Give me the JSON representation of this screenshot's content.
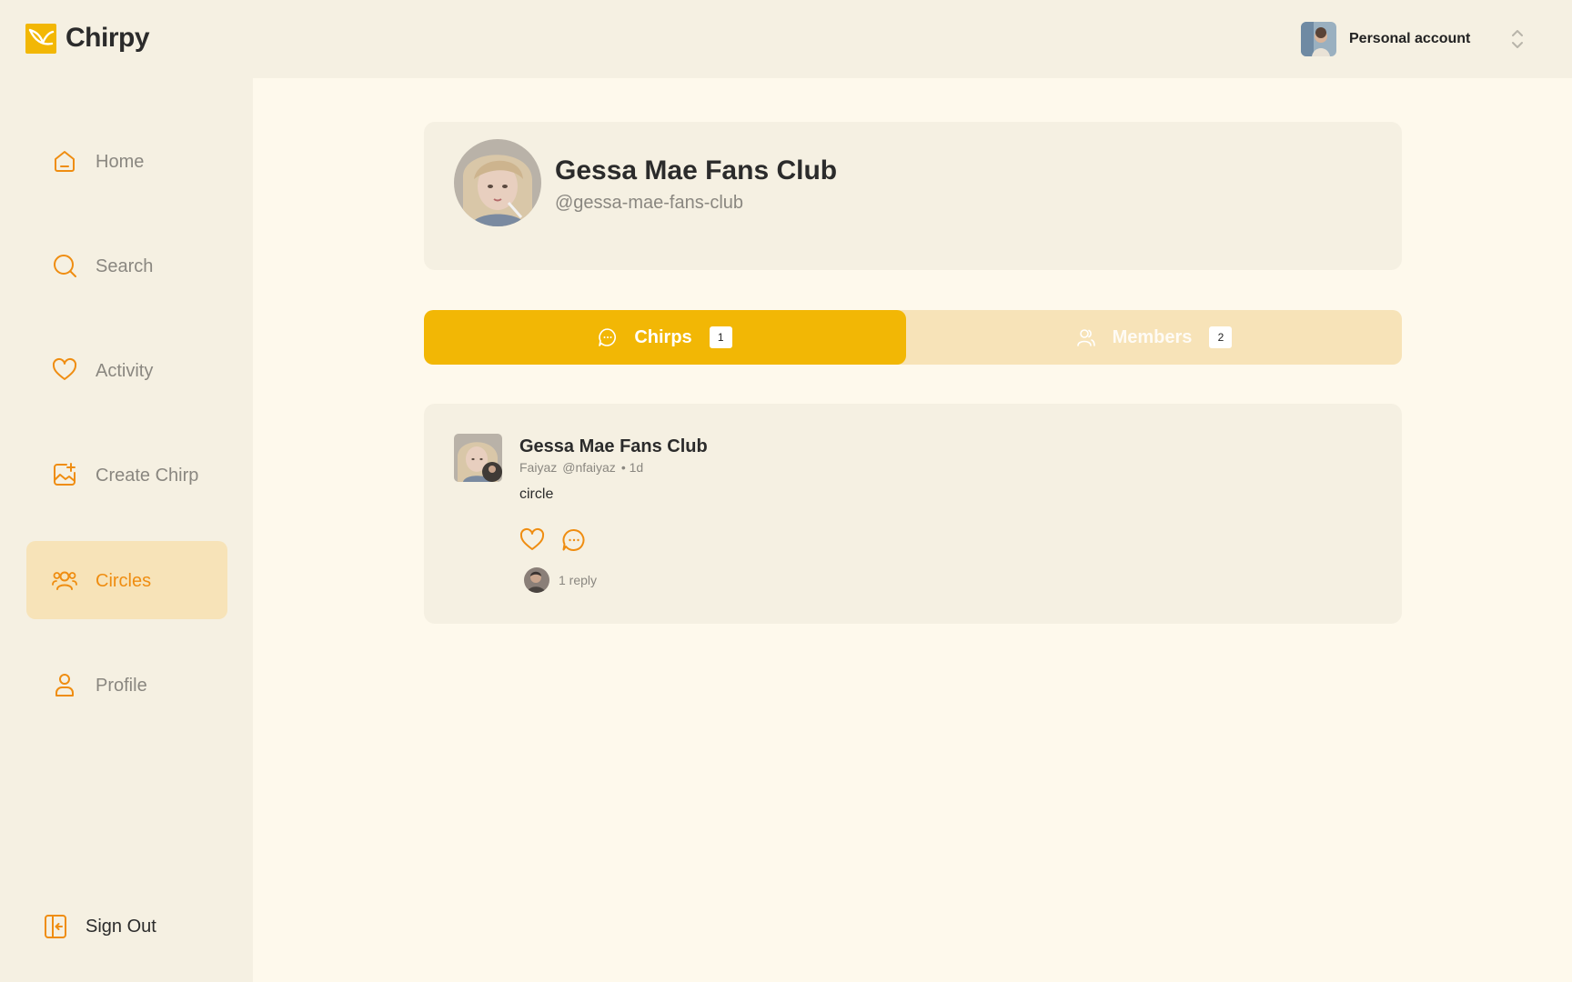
{
  "app": {
    "name": "Chirpy"
  },
  "account": {
    "label": "Personal account"
  },
  "sidebar": {
    "items": [
      {
        "label": "Home",
        "icon": "home-icon",
        "active": false
      },
      {
        "label": "Search",
        "icon": "search-icon",
        "active": false
      },
      {
        "label": "Activity",
        "icon": "heart-icon",
        "active": false
      },
      {
        "label": "Create Chirp",
        "icon": "image-plus-icon",
        "active": false
      },
      {
        "label": "Circles",
        "icon": "users-icon",
        "active": true
      },
      {
        "label": "Profile",
        "icon": "user-icon",
        "active": false
      }
    ],
    "signout_label": "Sign Out"
  },
  "circle": {
    "name": "Gessa Mae Fans Club",
    "handle": "@gessa-mae-fans-club"
  },
  "tabs": [
    {
      "label": "Chirps",
      "count": "1",
      "active": true,
      "icon": "chat-icon"
    },
    {
      "label": "Members",
      "count": "2",
      "active": false,
      "icon": "users-icon"
    }
  ],
  "post": {
    "circle_name": "Gessa Mae Fans Club",
    "author_name": "Faiyaz",
    "author_handle": "@nfaiyaz",
    "time": "• 1d",
    "text": "circle",
    "replies_label": "1 reply"
  },
  "colors": {
    "accent": "#f2b705",
    "icon": "#ef8d11",
    "active_bg": "#f7e3b8",
    "panel": "#f5f0e2",
    "background": "#fef9ec"
  }
}
